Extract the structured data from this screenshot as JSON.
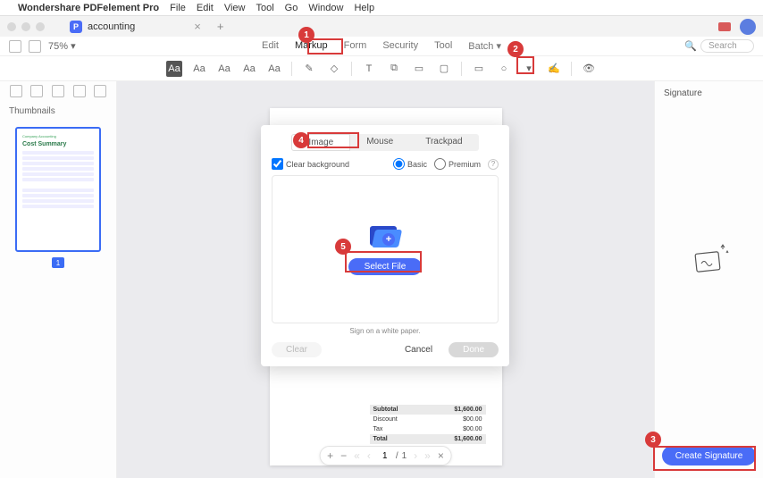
{
  "mac_menu": {
    "app": "Wondershare PDFelement Pro",
    "items": [
      "File",
      "Edit",
      "View",
      "Tool",
      "Go",
      "Window",
      "Help"
    ]
  },
  "document": {
    "name": "accounting"
  },
  "zoom": "75%",
  "top_tabs": [
    "Edit",
    "Markup",
    "Form",
    "Security",
    "Tool",
    "Batch"
  ],
  "top_tabs_active": "Markup",
  "search_placeholder": "Search",
  "markup_tools": {
    "highlight_fill": "Aa",
    "strike": "Aa",
    "underline": "Aa",
    "squiggly": "Aa",
    "replace": "Aa"
  },
  "left_panel": {
    "title": "Thumbnails",
    "thumb": {
      "header": "Company Accounting",
      "title": "Cost Summary",
      "page_num": "1"
    }
  },
  "doc_summary": {
    "rows": [
      {
        "label": "Subtotal",
        "value": "$1,600.00"
      },
      {
        "label": "Discount",
        "value": "$00.00"
      },
      {
        "label": "Tax",
        "value": "$00.00"
      },
      {
        "label": "Total",
        "value": "$1,600.00"
      }
    ]
  },
  "page_nav": {
    "current": "1",
    "total": "1"
  },
  "right_panel": {
    "title": "Signature",
    "create_button": "Create Signature"
  },
  "dialog": {
    "tabs": [
      "Image",
      "Mouse",
      "Trackpad"
    ],
    "active_tab": "Image",
    "clear_bg_label": "Clear background",
    "basic_label": "Basic",
    "premium_label": "Premium",
    "select_file": "Select File",
    "hint": "Sign on a white paper.",
    "clear": "Clear",
    "cancel": "Cancel",
    "done": "Done"
  },
  "callouts": [
    "1",
    "2",
    "3",
    "4",
    "5"
  ]
}
